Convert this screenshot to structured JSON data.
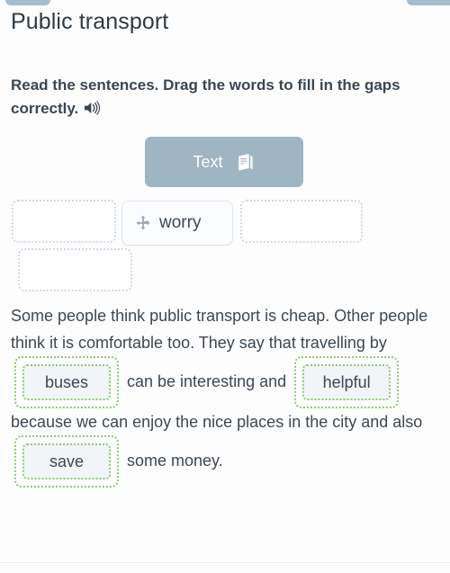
{
  "window": {
    "background_color": "#fdfdfd",
    "top_tabs": [
      {
        "name": "left-tab-pill",
        "color": "#a7bdcd"
      },
      {
        "name": "right-tab-pill",
        "color": "#a7bdcd"
      }
    ]
  },
  "header": {
    "title": "Public transport"
  },
  "instruction": {
    "text": "Read the sentences. Drag the words to fill in the gaps correctly.",
    "audio_icon": "speaker-icon"
  },
  "text_button": {
    "label": "Text",
    "icon": "book-icon",
    "background_color": "#9fb5c3",
    "text_color": "#ffffff"
  },
  "drag_bank": {
    "empty_slots": [
      {
        "id": "slot-a",
        "value": ""
      },
      {
        "id": "slot-b",
        "value": ""
      },
      {
        "id": "slot-c",
        "value": ""
      }
    ],
    "chips": [
      {
        "label": "worry",
        "icon": "move-icon"
      }
    ]
  },
  "passage": {
    "part1": "Some people think public transport is cheap. Other people think it is comfortable too. They say that travelling by ",
    "answer1": "buses",
    "part2": " can be interesting and ",
    "answer2": "helpful",
    "part3": " because we can enjoy the nice places in the city and also ",
    "answer3": "save",
    "part4": " some money."
  },
  "colors": {
    "answer_border": "#8cca72",
    "answer_fill": "#f2f5f8",
    "accent": "#9fb5c3",
    "body_text": "#3d4852",
    "empty_slot_border": "#cfd9e2"
  }
}
